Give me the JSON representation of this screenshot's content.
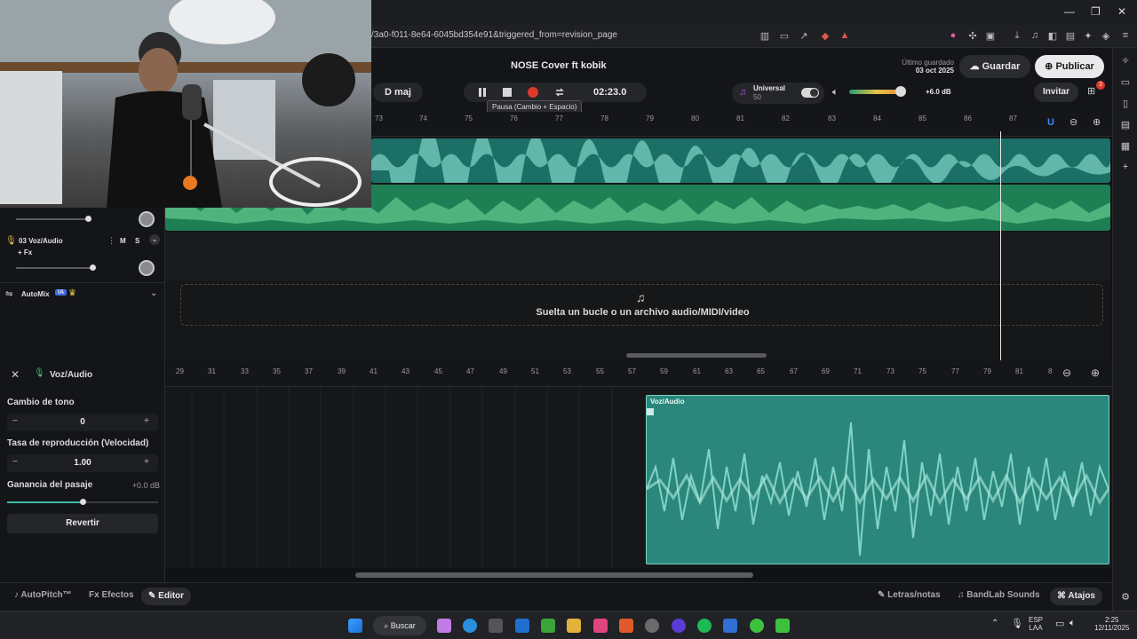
{
  "browser": {
    "url_fragment": "/3a0-f011-8e64-6045bd354e91&triggered_from=revision_page",
    "window_controls": [
      "—",
      "❐",
      "✕"
    ]
  },
  "header": {
    "project_title": "NOSE Cover ft kobik",
    "key": "D maj",
    "time": "02:23.0",
    "tooltip": "Pausa (Cambio + Espacio)",
    "last_saved_label": "Último guardado",
    "last_saved_date": "03 oct 2025",
    "save_button": "Guardar",
    "publish_button": "Publicar",
    "invite_button": "Invitar",
    "notification_count": "3",
    "universal_label": "Universal",
    "universal_value": "50",
    "master_gain": "+6.0 dB"
  },
  "ruler_top": [
    "73",
    "74",
    "75",
    "76",
    "77",
    "78",
    "79",
    "80",
    "81",
    "82",
    "83",
    "84",
    "85",
    "86",
    "87"
  ],
  "tracks": {
    "track3_name": "03 Voz/Audio",
    "mute": "M",
    "solo": "S",
    "fx_label": "+ Fx",
    "automix_label": "AutoMix",
    "automix_badge": "IA"
  },
  "dropzone_text": "Suelta un bucle o un archivo audio/MIDI/video",
  "editor": {
    "panel_title": "Voz/Audio",
    "pitch_label": "Cambio de tono",
    "pitch_value": "0",
    "rate_label": "Tasa de reproducción (Velocidad)",
    "rate_value": "1.00",
    "gain_label": "Ganancia del pasaje",
    "gain_value": "+0.0 dB",
    "revert_button": "Revertir",
    "clip_label": "Voz/Audio"
  },
  "ruler_bottom": [
    "29",
    "31",
    "33",
    "35",
    "37",
    "39",
    "41",
    "43",
    "45",
    "47",
    "49",
    "51",
    "53",
    "55",
    "57",
    "59",
    "61",
    "63",
    "65",
    "67",
    "69",
    "71",
    "73",
    "75",
    "77",
    "79",
    "81",
    "8"
  ],
  "bottom_bar": {
    "autopitch": "AutoPitch™",
    "effects": "Efectos",
    "editor": "Editor",
    "lyrics": "Letras/notas",
    "sounds": "BandLab Sounds",
    "shortcuts": "Atajos"
  },
  "taskbar": {
    "search": "Buscar",
    "lang_top": "ESP",
    "lang_bottom": "LAA",
    "time": "2:25",
    "date": "12/11/2025"
  },
  "colors": {
    "accent_teal": "#1c6f66",
    "accent_green": "#1f7f54",
    "record_red": "#e0392b"
  }
}
